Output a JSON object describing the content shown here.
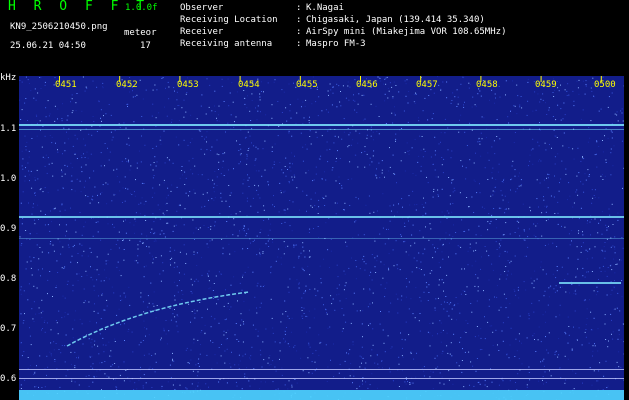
{
  "header": {
    "title": "H R O F F T",
    "version": "1.0.0f",
    "filename": "KN9_2506210450.png",
    "meteor_label": "meteor",
    "meteor_count": "17",
    "datetime": "25.06.21 04:50"
  },
  "info": [
    {
      "key": "Observer",
      "value": "K.Nagai"
    },
    {
      "key": "Receiving Location",
      "value": "Chigasaki, Japan (139.414 35.340)"
    },
    {
      "key": "Receiver",
      "value": "AirSpy mini (Miakejima VOR 108.65MHz)"
    },
    {
      "key": "Receiving antenna",
      "value": "Maspro FM-3"
    }
  ],
  "axis": {
    "y_unit": "kHz",
    "y_labels": [
      "1.1",
      "1.0",
      "0.9",
      "0.8",
      "0.7",
      "0.6"
    ],
    "time_labels": [
      "0451",
      "0452",
      "0453",
      "0454",
      "0455",
      "0456",
      "0457",
      "0458",
      "0459",
      "0500"
    ]
  },
  "colors": {
    "background": "#121d8a",
    "signal": "#7fe8ff",
    "tick": "#ffff00",
    "bottom_band": "#4fd6ff"
  }
}
